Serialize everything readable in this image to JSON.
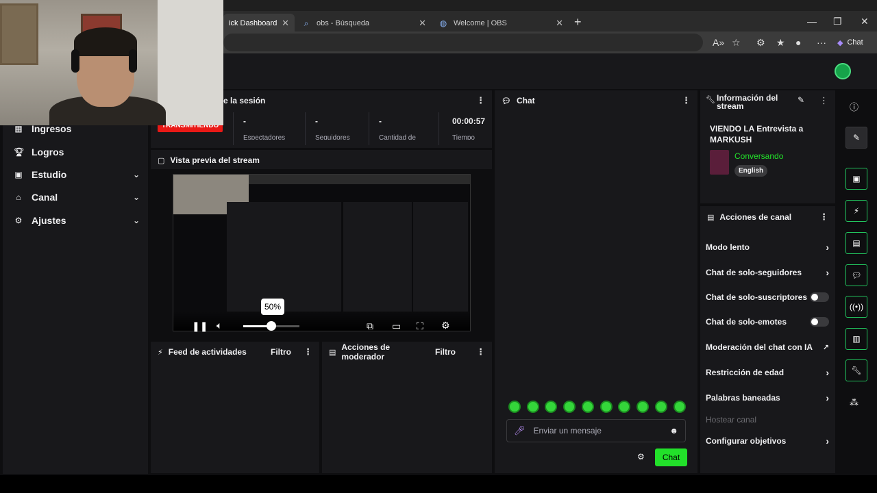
{
  "browser": {
    "tabs": [
      {
        "label": "ick Dashboard",
        "active": true
      },
      {
        "label": "obs - Búsqueda",
        "active": false
      },
      {
        "label": "Welcome | OBS",
        "active": false
      }
    ],
    "chat_button": "Chat"
  },
  "sidebar": {
    "items": [
      {
        "label": "Ingresos",
        "icon": "ingresos-icon",
        "expandable": false
      },
      {
        "label": "Logros",
        "icon": "trophy-icon",
        "expandable": false
      },
      {
        "label": "Estudio",
        "icon": "studio-icon",
        "expandable": true
      },
      {
        "label": "Canal",
        "icon": "channel-icon",
        "expandable": true
      },
      {
        "label": "Ajustes",
        "icon": "gear-icon",
        "expandable": true
      }
    ]
  },
  "session": {
    "title": "e la sesión",
    "live_badge": "TRANSMITIENDO",
    "stats": [
      {
        "value": "-",
        "label": "Espectadores"
      },
      {
        "value": "-",
        "label": "Seguidores"
      },
      {
        "value": "-",
        "label": "Cantidad de"
      },
      {
        "value": "00:00:57",
        "label": "Tiempo"
      }
    ]
  },
  "preview": {
    "title": "Vista previa del stream",
    "volume_tooltip": "50%",
    "volume_level": 0.5
  },
  "feed": {
    "title": "Feed de actividades",
    "filter": "Filtro"
  },
  "mod_actions": {
    "title": "Acciones de moderador",
    "filter": "Filtro"
  },
  "chat": {
    "title": "Chat",
    "placeholder": "Enviar un mensaje",
    "send_label": "Chat"
  },
  "stream_info": {
    "title": "Información del stream",
    "stream_title": "VIENDO LA Entrevista a MARKUSH",
    "category": "Conversando",
    "tag": "English",
    "accent": "#22e02a"
  },
  "channel_actions": {
    "title": "Acciones de canal",
    "items": [
      {
        "label": "Modo lento",
        "control": "arrow"
      },
      {
        "label": "Chat de solo-seguidores",
        "control": "arrow"
      },
      {
        "label": "Chat de solo-suscriptores",
        "control": "toggle"
      },
      {
        "label": "Chat de solo-emotes",
        "control": "toggle"
      },
      {
        "label": "Moderación del chat con IA",
        "control": "external"
      },
      {
        "label": "Restricción de edad",
        "control": "arrow"
      },
      {
        "label": "Palabras baneadas",
        "control": "arrow"
      },
      {
        "label": "Hostear canal",
        "control": "disabled"
      },
      {
        "label": "Configurar objetivos",
        "control": "arrow"
      }
    ]
  }
}
